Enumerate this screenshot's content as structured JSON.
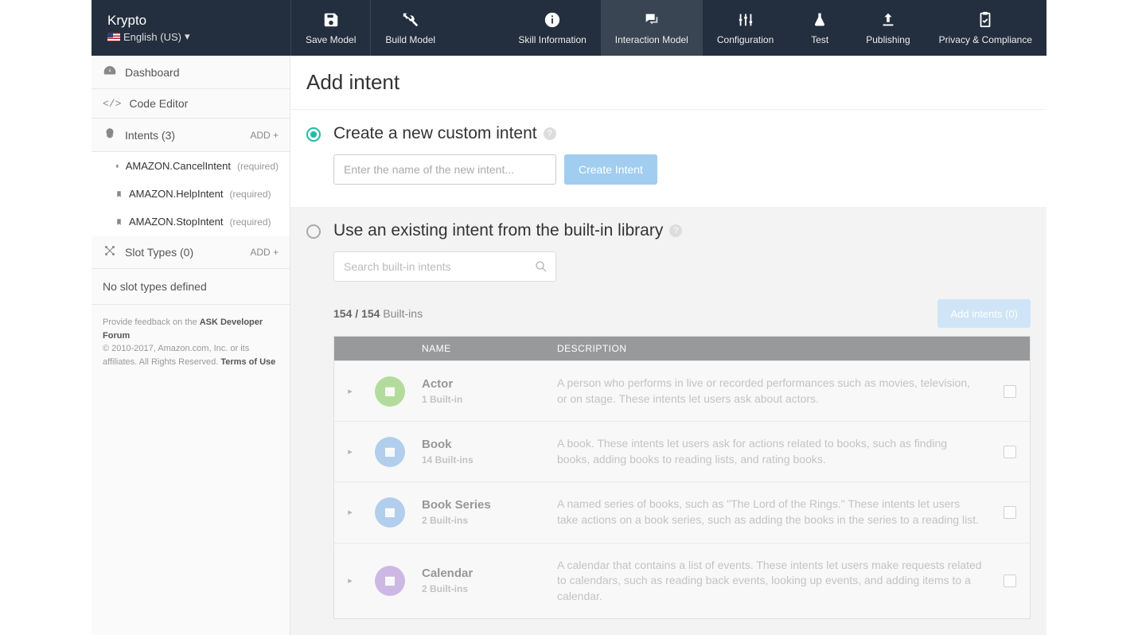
{
  "header": {
    "skill_name": "Krypto",
    "locale_label": "English (US)",
    "save_label": "Save Model",
    "build_label": "Build Model",
    "tabs": {
      "skill_info": "Skill Information",
      "interaction": "Interaction Model",
      "config": "Configuration",
      "test": "Test",
      "publishing": "Publishing",
      "privacy": "Privacy & Compliance"
    }
  },
  "sidebar": {
    "dashboard": "Dashboard",
    "code_editor": "Code Editor",
    "intents_label": "Intents (3)",
    "add_label": "ADD +",
    "intents": [
      {
        "name": "AMAZON.CancelIntent",
        "req": "(required)"
      },
      {
        "name": "AMAZON.HelpIntent",
        "req": "(required)"
      },
      {
        "name": "AMAZON.StopIntent",
        "req": "(required)"
      }
    ],
    "slot_types_label": "Slot Types (0)",
    "slot_empty": "No slot types defined",
    "footer_prefix": "Provide feedback on the ",
    "footer_forum": "ASK Developer Forum",
    "footer_copy": "© 2010-2017, Amazon.com, Inc. or its affiliates. All Rights Reserved. ",
    "footer_terms": "Terms of Use"
  },
  "main": {
    "title": "Add intent",
    "custom_title": "Create a new custom intent",
    "custom_placeholder": "Enter the name of the new intent...",
    "create_btn": "Create Intent",
    "lib_title": "Use an existing intent from the built-in library",
    "search_placeholder": "Search built-in intents",
    "count_bold": "154 / 154",
    "count_suffix": " Built-ins",
    "add_all_btn": "Add intents (0)",
    "thead": {
      "name": "NAME",
      "desc": "DESCRIPTION"
    },
    "rows": [
      {
        "name": "Actor",
        "count": "1 Built-in",
        "desc": "A person who performs in live or recorded performances such as movies, television, or on stage. These intents let users ask about actors.",
        "color": "#a9d98d"
      },
      {
        "name": "Book",
        "count": "14 Built-ins",
        "desc": "A book. These intents let users ask for actions related to books, such as finding books, adding books to reading lists, and rating books.",
        "color": "#a7c8ed"
      },
      {
        "name": "Book Series",
        "count": "2 Built-ins",
        "desc": "A named series of books, such as \"The Lord of the Rings.\" These intents let users take actions on a book series, such as adding the books in the series to a reading list.",
        "color": "#a7c8ed"
      },
      {
        "name": "Calendar",
        "count": "2 Built-ins",
        "desc": "A calendar that contains a list of events. These intents let users make requests related to calendars, such as reading back events, looking up events, and adding items to a calendar.",
        "color": "#c7aee3"
      }
    ]
  }
}
